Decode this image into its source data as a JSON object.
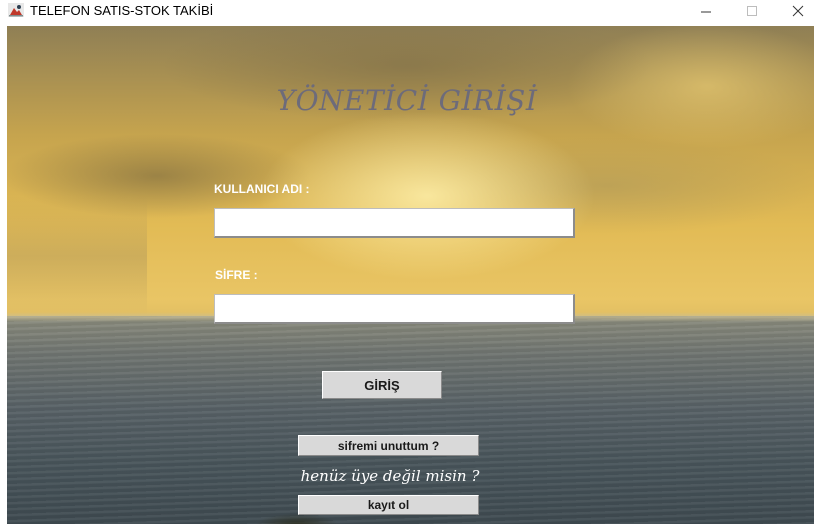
{
  "window": {
    "title": "TELEFON SATIS-STOK TAKİBİ",
    "icon": "java-app-icon",
    "controls": {
      "minimize_icon": "minimize-icon",
      "maximize_icon": "maximize-icon",
      "close_icon": "close-icon"
    }
  },
  "login": {
    "heading": "YÖNETİCİ GİRİŞİ",
    "username_label": "KULLANICI ADI :",
    "username_value": "",
    "password_label": "SİFRE :",
    "password_value": "",
    "login_button": "GİRİŞ",
    "forgot_button": "sifremi unuttum ?",
    "not_member_text": "henüz üye değil misin ?",
    "register_button": "kayıt ol"
  },
  "colors": {
    "heading": "#6d6b7a",
    "label": "#ffffff",
    "button_bg": "#d9d9d9"
  }
}
